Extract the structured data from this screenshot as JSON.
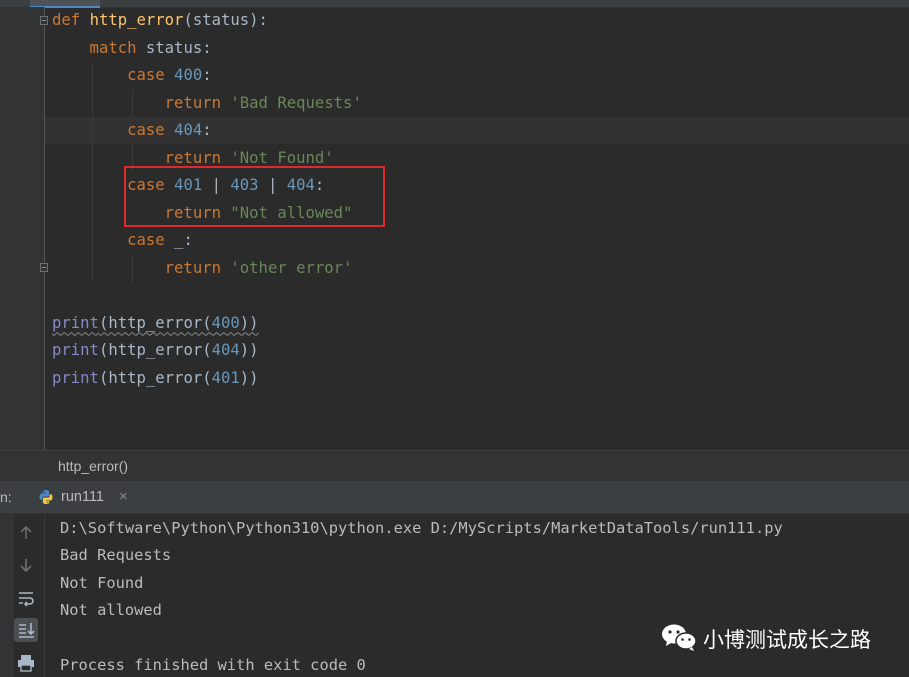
{
  "editor": {
    "lines": [
      {
        "tokens": [
          {
            "t": "def ",
            "c": "kw"
          },
          {
            "t": "http_error",
            "c": "fn"
          },
          {
            "t": "(status):",
            "c": ""
          }
        ]
      },
      {
        "tokens": [
          {
            "t": "    match ",
            "c": "kw"
          },
          {
            "t": "status:",
            "c": ""
          }
        ]
      },
      {
        "tokens": [
          {
            "t": "        case ",
            "c": "kw"
          },
          {
            "t": "400",
            "c": "num"
          },
          {
            "t": ":",
            "c": ""
          }
        ]
      },
      {
        "tokens": [
          {
            "t": "            return ",
            "c": "kw"
          },
          {
            "t": "'Bad Requests'",
            "c": "str"
          }
        ]
      },
      {
        "tokens": [
          {
            "t": "        case ",
            "c": "kw"
          },
          {
            "t": "404",
            "c": "num"
          },
          {
            "t": ":",
            "c": ""
          }
        ]
      },
      {
        "tokens": [
          {
            "t": "            return ",
            "c": "kw"
          },
          {
            "t": "'Not Found'",
            "c": "str"
          }
        ]
      },
      {
        "tokens": [
          {
            "t": "        case ",
            "c": "kw"
          },
          {
            "t": "401",
            "c": "num"
          },
          {
            "t": " | ",
            "c": ""
          },
          {
            "t": "403",
            "c": "num"
          },
          {
            "t": " | ",
            "c": ""
          },
          {
            "t": "404",
            "c": "num"
          },
          {
            "t": ":",
            "c": ""
          }
        ]
      },
      {
        "tokens": [
          {
            "t": "            return ",
            "c": "kw"
          },
          {
            "t": "\"Not allowed\"",
            "c": "str"
          }
        ]
      },
      {
        "tokens": [
          {
            "t": "        case ",
            "c": "kw"
          },
          {
            "t": "_:",
            "c": ""
          }
        ]
      },
      {
        "tokens": [
          {
            "t": "            return ",
            "c": "kw"
          },
          {
            "t": "'other error'",
            "c": "str"
          }
        ]
      },
      {
        "tokens": []
      },
      {
        "tokens": [
          {
            "t": "print",
            "c": "bi squig"
          },
          {
            "t": "(http_error(",
            "c": "squig"
          },
          {
            "t": "400",
            "c": "num squig"
          },
          {
            "t": "))",
            "c": "squig"
          }
        ]
      },
      {
        "tokens": [
          {
            "t": "print",
            "c": "bi"
          },
          {
            "t": "(http_error(",
            "c": ""
          },
          {
            "t": "404",
            "c": "num"
          },
          {
            "t": "))",
            "c": ""
          }
        ]
      },
      {
        "tokens": [
          {
            "t": "print",
            "c": "bi"
          },
          {
            "t": "(http_error(",
            "c": ""
          },
          {
            "t": "401",
            "c": "num"
          },
          {
            "t": "))",
            "c": ""
          }
        ]
      }
    ]
  },
  "breadcrumb": {
    "text": "http_error()"
  },
  "run": {
    "label": "n:",
    "tab_name": "run111",
    "close_glyph": "×",
    "output": [
      "D:\\Software\\Python\\Python310\\python.exe D:/MyScripts/MarketDataTools/run111.py",
      "Bad Requests",
      "Not Found",
      "Not allowed",
      "",
      "Process finished with exit code 0"
    ]
  },
  "watermark": {
    "text": "小博测试成长之路"
  },
  "colors": {
    "keyword": "#cc7832",
    "function": "#ffc66d",
    "number": "#6897bb",
    "string": "#6a8759",
    "builtin": "#8888c6",
    "highlight_box": "#e0282f"
  }
}
